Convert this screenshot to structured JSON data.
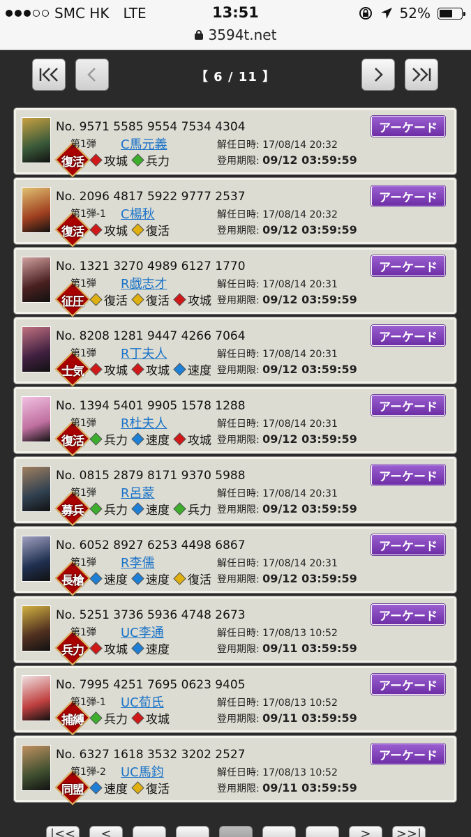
{
  "status": {
    "carrier": "SMC HK",
    "network": "LTE",
    "time": "13:51",
    "battery": "52%"
  },
  "url": "3594t.net",
  "pager": {
    "first": "|<<",
    "prev": "<",
    "indicator": "【 6 / 11 】",
    "next": ">",
    "last": ">>|"
  },
  "cards": [
    {
      "no": "No. 9571 5585 9554 7534 4304",
      "wave": "第1弾",
      "name": "C馬元義",
      "emblem": "復活",
      "skills": [
        [
          "red",
          "攻城"
        ],
        [
          "green",
          "兵力"
        ]
      ],
      "date_label": "解任日時:",
      "date": "17/08/14 20:32",
      "limit_label": "登用期限:",
      "limit": "09/12 03:59:59",
      "button": "アーケード"
    },
    {
      "no": "No. 2096 4817 5922 9777 2537",
      "wave": "第1弾-1",
      "name": "C楊秋",
      "emblem": "復活",
      "skills": [
        [
          "red",
          "攻城"
        ],
        [
          "yellow",
          "復活"
        ]
      ],
      "date_label": "解任日時:",
      "date": "17/08/14 20:32",
      "limit_label": "登用期限:",
      "limit": "09/12 03:59:59",
      "button": "アーケード"
    },
    {
      "no": "No. 1321 3270 4989 6127 1770",
      "wave": "第1弾",
      "name": "R戯志才",
      "emblem": "征圧",
      "skills": [
        [
          "yellow",
          "復活"
        ],
        [
          "yellow",
          "復活"
        ],
        [
          "red",
          "攻城"
        ]
      ],
      "date_label": "解任日時:",
      "date": "17/08/14 20:31",
      "limit_label": "登用期限:",
      "limit": "09/12 03:59:59",
      "button": "アーケード"
    },
    {
      "no": "No. 8208 1281 9447 4266 7064",
      "wave": "第1弾",
      "name": "R丁夫人",
      "emblem": "士気",
      "skills": [
        [
          "red",
          "攻城"
        ],
        [
          "red",
          "攻城"
        ],
        [
          "blue",
          "速度"
        ]
      ],
      "date_label": "解任日時:",
      "date": "17/08/14 20:31",
      "limit_label": "登用期限:",
      "limit": "09/12 03:59:59",
      "button": "アーケード"
    },
    {
      "no": "No. 1394 5401 9905 1578 1288",
      "wave": "第1弾",
      "name": "R杜夫人",
      "emblem": "復活",
      "skills": [
        [
          "green",
          "兵力"
        ],
        [
          "blue",
          "速度"
        ],
        [
          "red",
          "攻城"
        ]
      ],
      "date_label": "解任日時:",
      "date": "17/08/14 20:31",
      "limit_label": "登用期限:",
      "limit": "09/12 03:59:59",
      "button": "アーケード"
    },
    {
      "no": "No. 0815 2879 8171 9370 5988",
      "wave": "第1弾",
      "name": "R呂蒙",
      "emblem": "募兵",
      "skills": [
        [
          "green",
          "兵力"
        ],
        [
          "blue",
          "速度"
        ],
        [
          "green",
          "兵力"
        ]
      ],
      "date_label": "解任日時:",
      "date": "17/08/14 20:31",
      "limit_label": "登用期限:",
      "limit": "09/12 03:59:59",
      "button": "アーケード"
    },
    {
      "no": "No. 6052 8927 6253 4498 6867",
      "wave": "第1弾",
      "name": "R李儒",
      "emblem": "長槍",
      "skills": [
        [
          "blue",
          "速度"
        ],
        [
          "blue",
          "速度"
        ],
        [
          "yellow",
          "復活"
        ]
      ],
      "date_label": "解任日時:",
      "date": "17/08/14 20:31",
      "limit_label": "登用期限:",
      "limit": "09/12 03:59:59",
      "button": "アーケード"
    },
    {
      "no": "No. 5251 3736 5936 4748 2673",
      "wave": "第1弾",
      "name": "UC李通",
      "emblem": "兵力",
      "skills": [
        [
          "red",
          "攻城"
        ],
        [
          "blue",
          "速度"
        ]
      ],
      "date_label": "解任日時:",
      "date": "17/08/13 10:52",
      "limit_label": "登用期限:",
      "limit": "09/11 03:59:59",
      "button": "アーケード"
    },
    {
      "no": "No. 7995 4251 7695 0623 9405",
      "wave": "第1弾-1",
      "name": "UC荀氏",
      "emblem": "捕縛",
      "skills": [
        [
          "green",
          "兵力"
        ],
        [
          "red",
          "攻城"
        ]
      ],
      "date_label": "解任日時:",
      "date": "17/08/13 10:52",
      "limit_label": "登用期限:",
      "limit": "09/11 03:59:59",
      "button": "アーケード"
    },
    {
      "no": "No. 6327 1618 3532 3202 2527",
      "wave": "第1弾-2",
      "name": "UC馬鈞",
      "emblem": "同盟",
      "skills": [
        [
          "blue",
          "速度"
        ],
        [
          "yellow",
          "復活"
        ]
      ],
      "date_label": "解任日時:",
      "date": "17/08/13 10:52",
      "limit_label": "登用期限:",
      "limit": "09/11 03:59:59",
      "button": "アーケード"
    }
  ],
  "colors": {
    "red": "#d01818",
    "green": "#3cae2c",
    "blue": "#1e7fd6",
    "yellow": "#e0b010",
    "arcade": "#7a3cb4",
    "link": "#1a73c9"
  }
}
